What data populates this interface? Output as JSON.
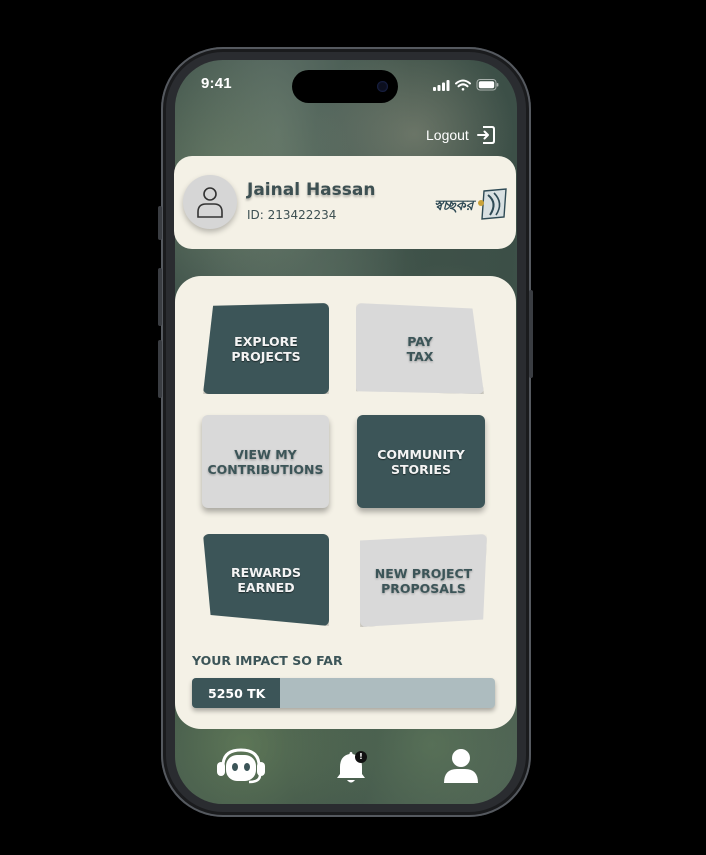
{
  "status_bar": {
    "time": "9:41"
  },
  "header": {
    "logout_label": "Logout"
  },
  "profile": {
    "name": "Jainal Hassan",
    "id_text": "ID: 213422234",
    "brand_text": "স্বচ্ছকর"
  },
  "tiles": [
    {
      "label": "EXPLORE\nPROJECTS",
      "style": "dark"
    },
    {
      "label": "PAY\nTAX",
      "style": "light"
    },
    {
      "label": "VIEW MY\nCONTRIBUTIONS",
      "style": "light"
    },
    {
      "label": "COMMUNITY\nSTORIES",
      "style": "dark"
    },
    {
      "label": "REWARDS\nEARNED",
      "style": "dark"
    },
    {
      "label": "NEW PROJECT\nPROPOSALS",
      "style": "light"
    }
  ],
  "impact": {
    "label": "YOUR IMPACT SO FAR",
    "value_text": "5250 TK",
    "progress_fraction": 0.29
  },
  "bottom_nav": {
    "items": [
      "support-bot-icon",
      "bell-icon",
      "profile-icon"
    ],
    "notification_badge": "!"
  },
  "colors": {
    "primary": "#3c5558",
    "card": "#f4f1e6",
    "tile_light": "#d9d9d9",
    "progress_track": "#adbcbf"
  }
}
